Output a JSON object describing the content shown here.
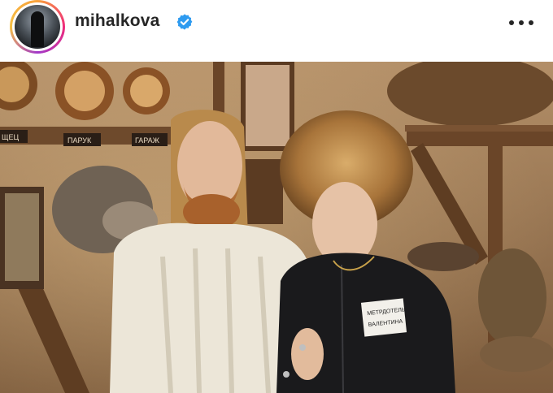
{
  "post": {
    "username": "mihalkova",
    "verified": true,
    "verified_icon": "verified-badge-icon",
    "more_icon": "more-options-icon",
    "colors": {
      "verified": "#2e9bf0",
      "username": "#262626",
      "story_ring": [
        "#f9a23b",
        "#ee2a7b",
        "#a238c9"
      ]
    }
  },
  "photo": {
    "wall_signs": [
      "ЩЕЦ",
      "ПАРУК",
      "ГАРАЖ"
    ],
    "badge_text": [
      "МЕТРДОТЕЛЬ",
      "ВАЛЕНТИНА"
    ]
  }
}
